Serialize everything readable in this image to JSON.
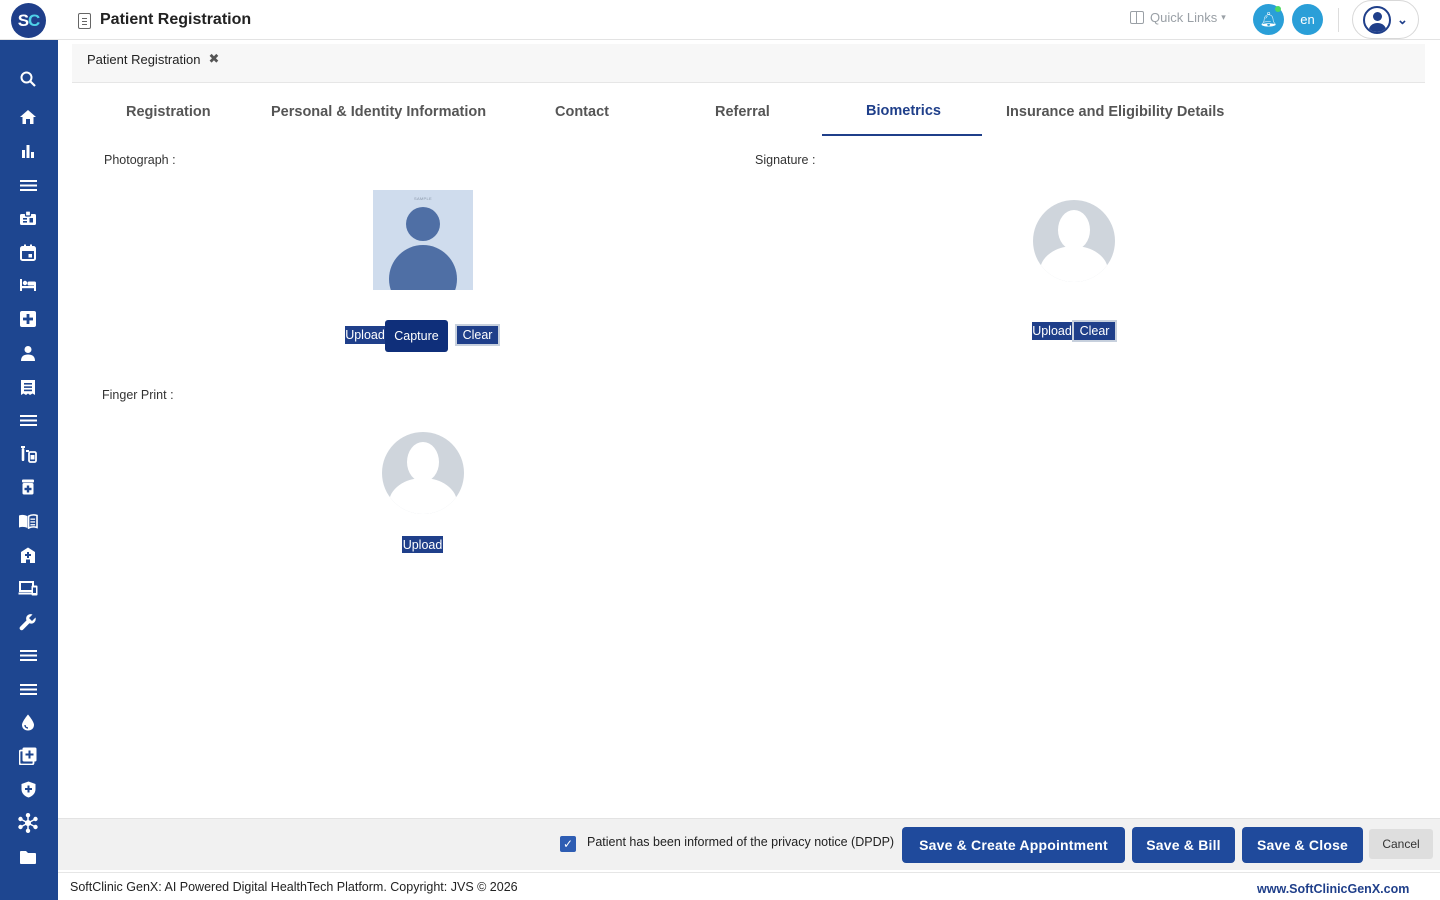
{
  "app": {
    "logo_text_s": "S",
    "logo_text_c": "C",
    "page_title": "Patient Registration",
    "quick_links": "Quick Links",
    "language": "en"
  },
  "sidebar": {
    "icons": [
      "search-icon",
      "home-icon",
      "chart-icon",
      "menu-icon",
      "badge-icon",
      "calendar-icon",
      "bed-icon",
      "medical-plus-icon",
      "person-icon",
      "receipt-icon",
      "list-icon",
      "lab-tubes-icon",
      "medicine-icon",
      "book-icon",
      "hospital-icon",
      "devices-icon",
      "wrench-icon",
      "menu-icon",
      "menu-icon",
      "drop-icon",
      "add-box-icon",
      "shield-icon",
      "hub-icon",
      "folder-icon"
    ]
  },
  "open_tab": {
    "label": "Patient Registration"
  },
  "tabs": [
    {
      "label": "Registration",
      "active": false
    },
    {
      "label": "Personal & Identity Information",
      "active": false
    },
    {
      "label": "Contact",
      "active": false
    },
    {
      "label": "Referral",
      "active": false
    },
    {
      "label": "Biometrics",
      "active": true
    },
    {
      "label": "Insurance and Eligibility Details",
      "active": false
    }
  ],
  "biometrics": {
    "photograph_label": "Photograph :",
    "photo_sample_text": "SAMPLE",
    "signature_label": "Signature :",
    "fingerprint_label": "Finger Print :",
    "upload": "Upload",
    "capture": "Capture",
    "clear": "Clear"
  },
  "actions": {
    "dpdp_label": "Patient has been informed of the privacy notice (DPDP)",
    "dpdp_checked": true,
    "save_appointment": "Save & Create Appointment",
    "save_bill": "Save & Bill",
    "save_close": "Save & Close",
    "cancel": "Cancel"
  },
  "footer": {
    "copyright": "SoftClinic GenX: AI Powered Digital HealthTech Platform. Copyright: JVS © 2026",
    "website": "www.SoftClinicGenX.com"
  },
  "colors": {
    "brand_blue": "#1f3f8a",
    "sidebar_blue": "#1e4690",
    "accent_cyan": "#2a9fd8"
  }
}
